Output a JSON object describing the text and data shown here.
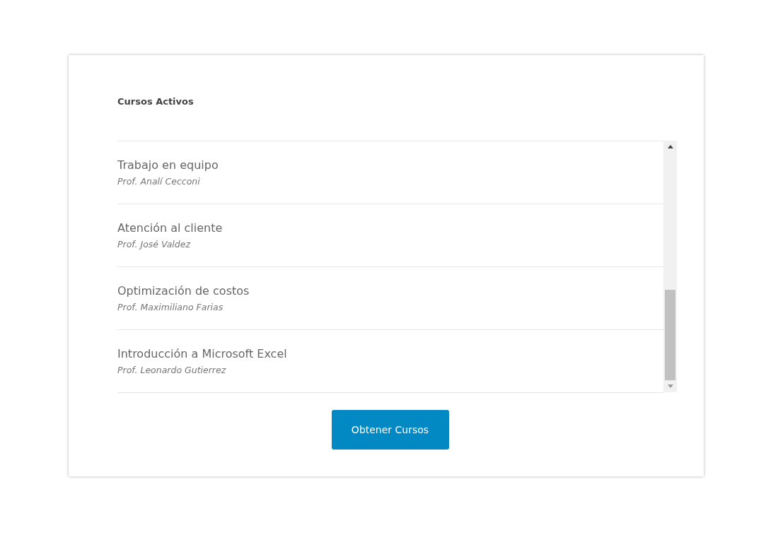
{
  "card": {
    "title": "Cursos Activos",
    "courses": [
      {
        "name": "Trabajo en equipo",
        "teacher": "Prof. Analí Cecconi"
      },
      {
        "name": "Atención al cliente",
        "teacher": "Prof. José Valdez"
      },
      {
        "name": "Optimización de costos",
        "teacher": "Prof. Maximiliano Farias"
      },
      {
        "name": "Introducción a Microsoft Excel",
        "teacher": "Prof. Leonardo Gutierrez"
      }
    ],
    "button": "Obtener Cursos"
  }
}
